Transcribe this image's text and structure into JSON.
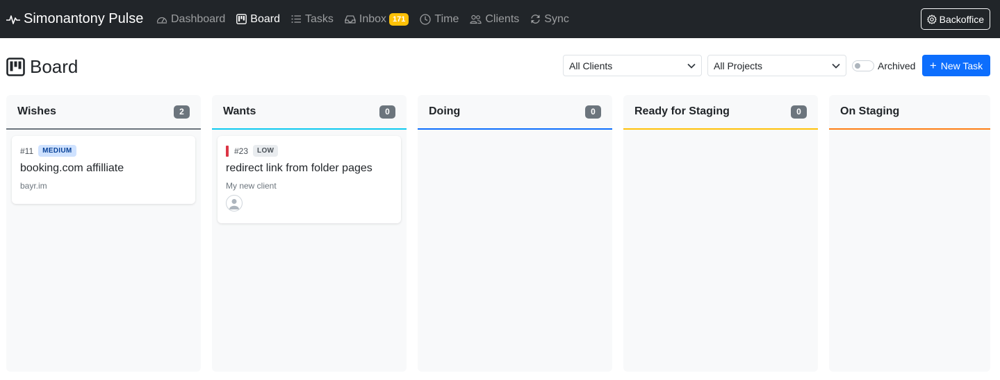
{
  "app": {
    "name": "Simonantony Pulse"
  },
  "nav": {
    "items": [
      {
        "label": "Dashboard",
        "icon": "speedometer-icon",
        "active": false
      },
      {
        "label": "Board",
        "icon": "kanban-icon",
        "active": true
      },
      {
        "label": "Tasks",
        "icon": "list-icon",
        "active": false
      },
      {
        "label": "Inbox",
        "icon": "inbox-icon",
        "active": false,
        "badge": "171"
      },
      {
        "label": "Time",
        "icon": "clock-icon",
        "active": false
      },
      {
        "label": "Clients",
        "icon": "people-icon",
        "active": false
      },
      {
        "label": "Sync",
        "icon": "sync-icon",
        "active": false
      }
    ],
    "backoffice_label": "Backoffice"
  },
  "page": {
    "title": "Board",
    "filters": {
      "clients": "All Clients",
      "projects": "All Projects"
    },
    "archived_label": "Archived",
    "archived_on": false,
    "new_task_label": "New Task"
  },
  "columns": [
    {
      "name": "Wishes",
      "count": "2",
      "color": "#6c757d"
    },
    {
      "name": "Wants",
      "count": "0",
      "color": "#0dcaf0"
    },
    {
      "name": "Doing",
      "count": "0",
      "color": "#0d6efd"
    },
    {
      "name": "Ready for Staging",
      "count": "0",
      "color": "#ffc107"
    },
    {
      "name": "On Staging",
      "count": "",
      "color": "#fd7e14"
    }
  ],
  "cards": [
    {
      "id": "#11",
      "priority": "MEDIUM",
      "title": "booking.com affilliate",
      "client": "bayr.im"
    },
    {
      "id": "#23",
      "priority": "LOW",
      "title": "redirect link from folder pages",
      "client": "My new client"
    }
  ],
  "colors": {
    "navbar": "#212529",
    "primary": "#0d6efd",
    "inbox_badge": "#ffc107"
  }
}
